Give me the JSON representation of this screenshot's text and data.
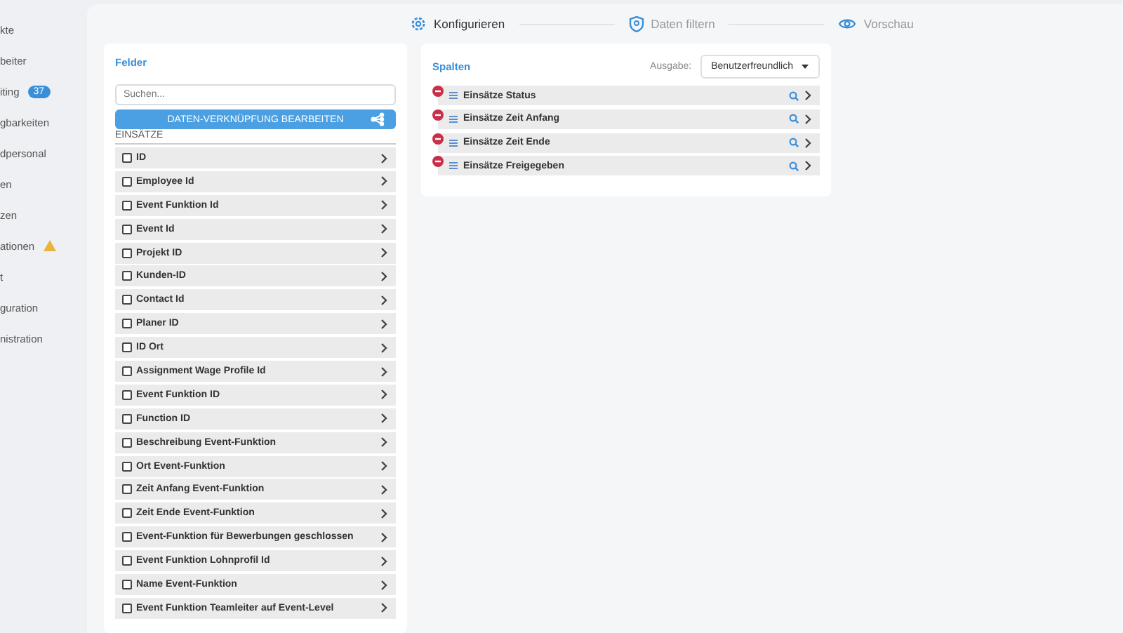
{
  "sidebar": {
    "items": [
      {
        "label": "kte",
        "warning": false
      },
      {
        "label": "beiter",
        "warning": false
      },
      {
        "label": "iting",
        "badge": "37",
        "warning": false
      },
      {
        "label": "gbarkeiten",
        "warning": false
      },
      {
        "label": "dpersonal",
        "warning": false
      },
      {
        "label": "en",
        "warning": false
      },
      {
        "label": "zen",
        "warning": false
      },
      {
        "label": "ationen",
        "warning": true
      },
      {
        "label": "t",
        "warning": false
      },
      {
        "label": "guration",
        "warning": false
      },
      {
        "label": "nistration",
        "warning": false
      }
    ]
  },
  "stepper": [
    {
      "label": "Konfigurieren",
      "kind": "gear",
      "selected": true
    },
    {
      "label": "Daten filtern",
      "kind": "shield",
      "selected": false
    },
    {
      "label": "Vorschau",
      "kind": "eye",
      "selected": false
    }
  ],
  "fields_panel": {
    "title": "Felder",
    "search": {
      "placeholder": "Suchen..."
    },
    "link_button": "DATEN-VERKNÜPFUNG BEARBEITEN",
    "group": "EINSÄTZE",
    "fields": [
      {
        "label": "ID",
        "checked": false
      },
      {
        "label": "Employee Id",
        "checked": false
      },
      {
        "label": "Event Funktion Id",
        "checked": false
      },
      {
        "label": "Event Id",
        "checked": false
      },
      {
        "label": "Projekt ID",
        "checked": false
      },
      {
        "label": "Kunden-ID",
        "checked": false
      },
      {
        "label": "Contact Id",
        "checked": false
      },
      {
        "label": "Planer ID",
        "checked": false
      },
      {
        "label": "ID Ort",
        "checked": false
      },
      {
        "label": "Assignment Wage Profile Id",
        "checked": false
      },
      {
        "label": "Event Funktion ID",
        "checked": false
      },
      {
        "label": "Function ID",
        "checked": false
      },
      {
        "label": "Beschreibung Event-Funktion",
        "checked": false
      },
      {
        "label": "Ort Event-Funktion",
        "checked": false
      },
      {
        "label": "Zeit Anfang Event-Funktion",
        "checked": false
      },
      {
        "label": "Zeit Ende Event-Funktion",
        "checked": false
      },
      {
        "label": "Event-Funktion für Bewerbungen geschlossen",
        "checked": false
      },
      {
        "label": "Event Funktion Lohnprofil Id",
        "checked": false
      },
      {
        "label": "Name Event-Funktion",
        "checked": false
      },
      {
        "label": "Event Funktion Teamleiter auf Event-Level",
        "checked": false
      }
    ]
  },
  "columns_panel": {
    "title": "Spalten",
    "output_label": "Ausgabe:",
    "output_value": "Benutzerfreundlich",
    "columns": [
      {
        "label": "Einsätze Status"
      },
      {
        "label": "Einsätze Zeit Anfang"
      },
      {
        "label": "Einsätze Zeit Ende"
      },
      {
        "label": "Einsätze Freigegeben"
      }
    ]
  }
}
